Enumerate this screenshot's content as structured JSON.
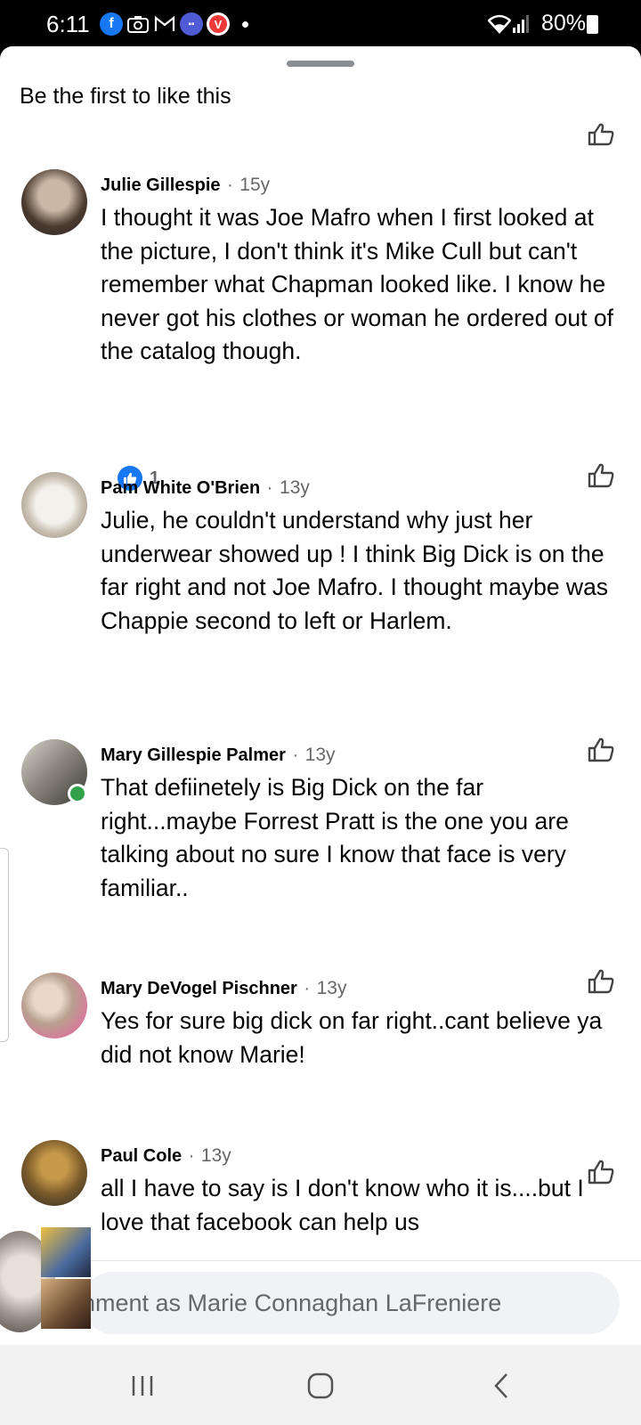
{
  "status_bar": {
    "time": "6:11",
    "battery": "80%",
    "notification_icons": [
      "facebook-icon",
      "camera-icon",
      "gmail-icon",
      "messages-icon",
      "vivaldi-icon",
      "dot-icon"
    ]
  },
  "sheet": {
    "title": "Be the first to like this"
  },
  "comments": [
    {
      "name": "Julie Gillespie",
      "time": "15y",
      "text": "I thought it was Joe Mafro when I first looked at the picture, I don't think it's Mike Cull but can't remember what Chapman looked like.  I know he never got his clothes or woman he ordered out of the catalog though.",
      "reactions": "1"
    },
    {
      "name": "Pam White O'Brien",
      "time": "13y",
      "text": "Julie, he couldn't understand why just her underwear showed up ! I think Big Dick is on the far right and not Joe Mafro. I thought maybe was Chappie second to left  or Harlem."
    },
    {
      "name": "Mary Gillespie Palmer",
      "time": "13y",
      "text": "That defiinetely is Big Dick on the far right...maybe Forrest Pratt is the one you are talking about no sure I know that face is very familiar.."
    },
    {
      "name": "Mary DeVogel Pischner",
      "time": "13y",
      "text": "Yes for sure big dick on far right..cant believe ya did not know Marie!"
    },
    {
      "name": "Paul Cole",
      "time": "13y",
      "text": "all I have to say is I don't know who it is....but I love that facebook can help us"
    }
  ],
  "composer": {
    "placeholder": "Comment as Marie Connaghan LaFreniere",
    "visible_text": "nment as Marie Connaghan LaFreniere"
  },
  "nav": {
    "buttons": [
      "recents-button",
      "home-button",
      "back-button"
    ]
  }
}
